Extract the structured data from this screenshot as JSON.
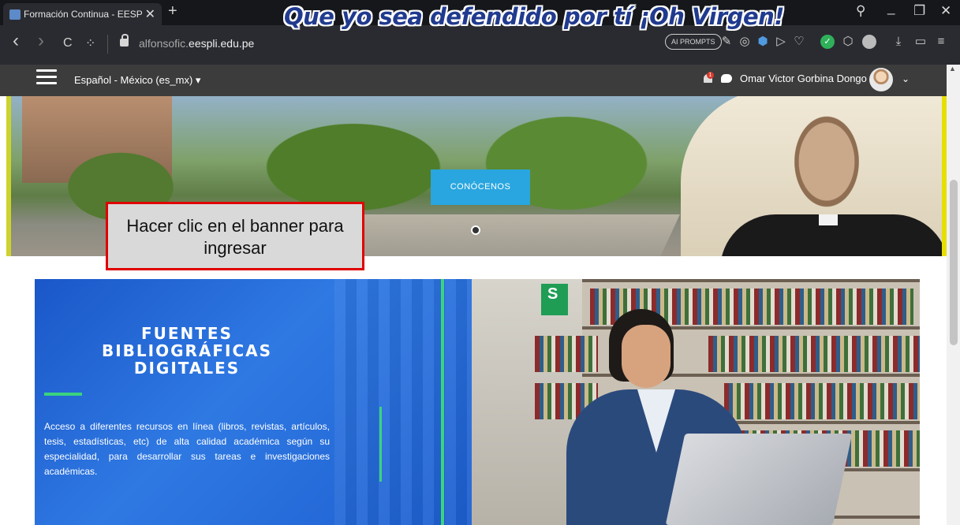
{
  "browser": {
    "tab_title": "Formación Continua - EESP",
    "tab_close": "✕",
    "new_tab": "+",
    "win_search": "⚲",
    "win_min": "_",
    "win_restore": "❐",
    "win_close": "✕",
    "url_prefix": "alfonsofic.",
    "url_domain": "eespli.edu.pe",
    "ai_prompts": "AI PROMPTS",
    "back_icon": "‹",
    "forward_icon": "›",
    "reload_icon": "C",
    "apps_icon": "⁘"
  },
  "moodle": {
    "language": "Español - México (es_mx)",
    "language_caret": "▾",
    "notification_count": "1",
    "user_name": "Omar Victor Gorbina Dongo",
    "user_caret": "⌄"
  },
  "hero": {
    "slogan": "Que yo sea defendido por tí ¡Oh Virgen!",
    "cta": "CONÓCENOS"
  },
  "callout": {
    "text": "Hacer clic en el banner para ingresar",
    "border_color": "#e00000"
  },
  "library_banner": {
    "title_line1": "FUENTES",
    "title_line2": "BIBLIOGRÁFICAS",
    "title_line3": "DIGITALES",
    "exit_sign": "S",
    "description": "Acceso a diferentes recursos en línea (libros, revistas, artículos, tesis, estadísticas, etc) de alta calidad académica según su especialidad, para desarrollar sus tareas e investigaciones académicas."
  },
  "colors": {
    "cta_blue": "#29a6df",
    "banner_blue": "#2f79e3",
    "accent_green": "#3bd37f",
    "navbar_dark": "#3c3c3c"
  }
}
